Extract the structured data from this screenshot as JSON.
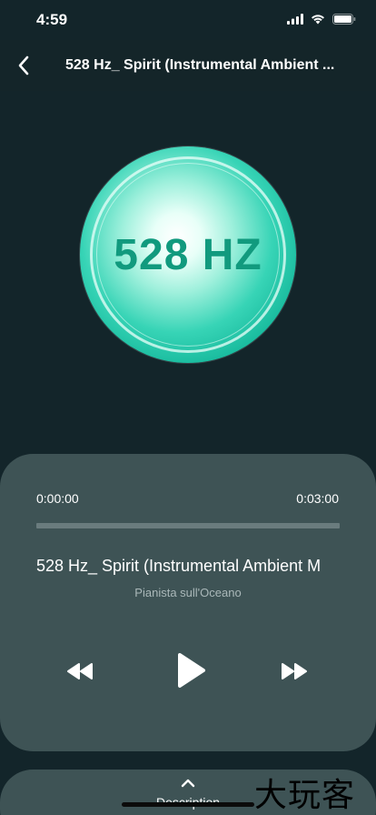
{
  "status": {
    "time": "4:59"
  },
  "nav": {
    "title": "528 Hz_ Spirit (Instrumental Ambient ..."
  },
  "artwork": {
    "text": "528 HZ"
  },
  "player": {
    "elapsed": "0:00:00",
    "total": "0:03:00",
    "progress": 0,
    "title": "528 Hz_ Spirit (Instrumental Ambient M",
    "artist": "Pianista sull'Oceano"
  },
  "description": {
    "label": "Description"
  },
  "watermark": {
    "text": "大玩客"
  },
  "icons": [
    "chevron-left-icon",
    "signal-icon",
    "wifi-icon",
    "battery-icon",
    "rewind-icon",
    "play-icon",
    "fast-forward-icon",
    "chevron-up-icon"
  ]
}
